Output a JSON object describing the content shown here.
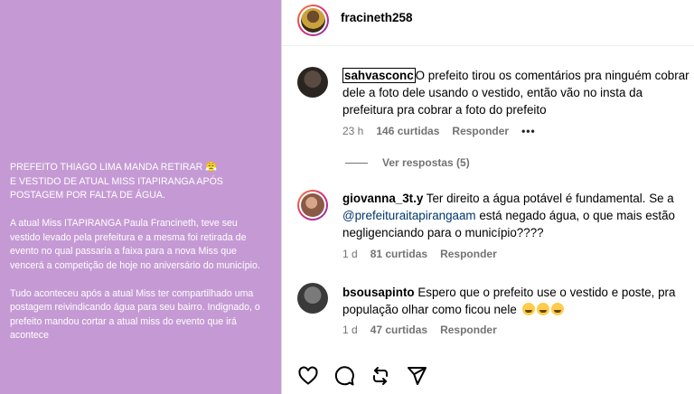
{
  "post_image": {
    "headline": "PREFEITO THIAGO LIMA  MANDA RETIRAR 😤\nE VESTIDO DE ATUAL MISS ITAPIRANGA APÓS\nPOSTAGEM POR FALTA DE ÁGUA.",
    "paragraph_1": "A atual Miss ITAPIRANGA Paula Francineth, teve seu vestido levado pela prefeitura e a mesma foi retirada de evento no qual passaria a faixa para a nova Miss que vencerá a competição de hoje no aniversário do município.",
    "paragraph_2": "Tudo aconteceu após a atual Miss ter compartilhado uma postagem reivindicando água para seu bairro. Indignado, o prefeito mandou cortar a atual miss do evento que irá acontece",
    "background_color": "#c59ad4"
  },
  "header": {
    "username": "fracineth258"
  },
  "comments": [
    {
      "username": "sahvasconc",
      "text": "O prefeito tirou os comentários pra ninguém cobrar dele a foto dele usando o vestido, então vão no insta da prefeitura pra cobrar a foto do prefeito",
      "time": "23 h",
      "likes": "146 curtidas",
      "reply": "Responder",
      "more": "•••"
    },
    {
      "username": "giovanna_3t.y",
      "text_before": " Ter direito a água potável é fundamental. Se a ",
      "mention": "@prefeituraitapirangaam",
      "text_after": " está negado água, o que mais estão negligenciando para o município????",
      "time": "1 d",
      "likes": "81 curtidas",
      "reply": "Responder"
    },
    {
      "username": "bsousapinto",
      "text": " Espero que o prefeito use o vestido e poste, pra população olhar como ficou nele",
      "emoji": "🤣🤣🤣",
      "time": "1 d",
      "likes": "47 curtidas",
      "reply": "Responder"
    }
  ],
  "view_replies": "Ver respostas (5)",
  "actions": {
    "like_icon": "heart-icon",
    "comment_icon": "comment-icon",
    "repost_icon": "repost-icon",
    "share_icon": "share-icon"
  }
}
